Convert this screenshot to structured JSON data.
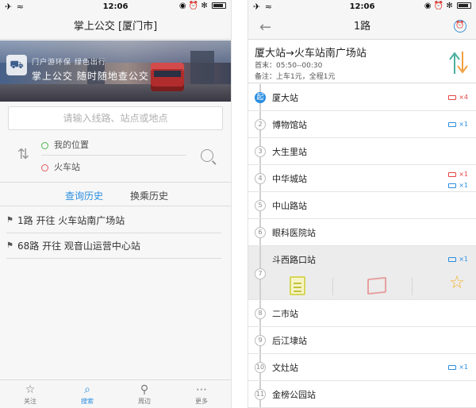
{
  "status": {
    "time": "12:06",
    "signal": "✈ ≈",
    "indicators": "◉ ⏰ ✻"
  },
  "left": {
    "nav_title": "掌上公交 [厦门市]",
    "banner": {
      "slogan": "门户游环保 绿色出行",
      "app_name": "掌上公交  随时随地查公交"
    },
    "search_placeholder": "请输入线路、站点或地点",
    "from_label": "我的位置",
    "to_label": "火车站",
    "tabs": {
      "history": "查询历史",
      "transfer": "换乘历史"
    },
    "history": [
      "1路 开往 火车站南广场站",
      "68路 开往 观音山运营中心站"
    ],
    "tabbar": [
      {
        "label": "关注",
        "icon": "☆"
      },
      {
        "label": "搜索",
        "icon": "⌕"
      },
      {
        "label": "周边",
        "icon": "⚲"
      },
      {
        "label": "更多",
        "icon": "⋯"
      }
    ]
  },
  "right": {
    "nav_title": "1路",
    "alarm_glyph": "⏰",
    "route_name": "厦大站→火车站南广场站",
    "hours": "首末：05:50--00:30",
    "fare": "备注：上车1元，全程1元",
    "stops": [
      {
        "num": "起",
        "name": "厦大站",
        "badges": [
          {
            "color": "red",
            "text": "×4"
          }
        ]
      },
      {
        "num": "2",
        "name": "博物馆站",
        "badges": [
          {
            "color": "blue",
            "text": "×1"
          }
        ]
      },
      {
        "num": "3",
        "name": "大生里站",
        "badges": []
      },
      {
        "num": "4",
        "name": "中华城站",
        "badges": [
          {
            "color": "red",
            "text": "×1"
          },
          {
            "color": "blue",
            "text": "×1"
          }
        ]
      },
      {
        "num": "5",
        "name": "中山路站",
        "badges": []
      },
      {
        "num": "6",
        "name": "眼科医院站",
        "badges": []
      },
      {
        "num": "7",
        "name": "斗西路口站",
        "badges": [
          {
            "color": "blue",
            "text": "×1"
          }
        ],
        "expanded": true
      },
      {
        "num": "8",
        "name": "二市站",
        "badges": []
      },
      {
        "num": "9",
        "name": "后江埭站",
        "badges": []
      },
      {
        "num": "10",
        "name": "文灶站",
        "badges": [
          {
            "color": "blue",
            "text": "×1"
          }
        ]
      },
      {
        "num": "11",
        "name": "金榜公园站",
        "badges": []
      }
    ]
  },
  "colors": {
    "accent": "#2a8ee0",
    "red_badge": "#e14545",
    "star": "#f0b128"
  }
}
